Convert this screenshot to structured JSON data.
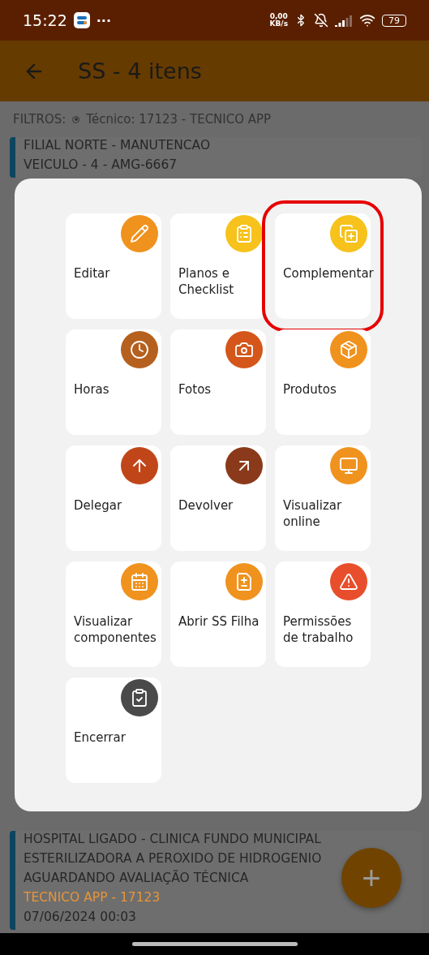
{
  "status_bar": {
    "time": "15:22",
    "more": "···",
    "net_speed": "0,00",
    "net_unit": "KB/s",
    "battery": "79"
  },
  "app_bar": {
    "title": "SS - 4 itens"
  },
  "filters": {
    "label": "FILTROS:",
    "chip": "Técnico: 17123 - TECNICO APP"
  },
  "list": [
    {
      "lines": [
        "FILIAL NORTE - MANUTENCAO",
        "VEICULO - 4 - AMG-6667"
      ]
    },
    {
      "lines": [
        "HOSPITAL LIGADO - CLINICA FUNDO MUNICIPAL",
        "ESTERILIZADORA A PEROXIDO DE HIDROGENIO",
        "AGUARDANDO AVALIAÇÃO TÉCNICA"
      ],
      "technician": "TECNICO APP - 17123",
      "date": "07/06/2024 00:03"
    }
  ],
  "fab": {
    "label": "+"
  },
  "actions": [
    {
      "label": "Editar",
      "color": "#f0921e",
      "highlighted": false
    },
    {
      "label": "Planos e Checklist",
      "color": "#f6c21b",
      "highlighted": false
    },
    {
      "label": "Complementar",
      "color": "#f6c21b",
      "highlighted": true
    },
    {
      "label": "Horas",
      "color": "#b5601e",
      "highlighted": false
    },
    {
      "label": "Fotos",
      "color": "#d4561a",
      "highlighted": false
    },
    {
      "label": "Produtos",
      "color": "#f0921e",
      "highlighted": false
    },
    {
      "label": "Delegar",
      "color": "#c0461a",
      "highlighted": false
    },
    {
      "label": "Devolver",
      "color": "#8a3a1a",
      "highlighted": false
    },
    {
      "label": "Visualizar online",
      "color": "#f0921e",
      "highlighted": false
    },
    {
      "label": "Visualizar componentes",
      "color": "#f0921e",
      "highlighted": false
    },
    {
      "label": "Abrir SS Filha",
      "color": "#f0921e",
      "highlighted": false
    },
    {
      "label": "Permissões de trabalho",
      "color": "#e84e2b",
      "highlighted": false
    },
    {
      "label": "Encerrar",
      "color": "#4a4a4a",
      "highlighted": false
    }
  ]
}
